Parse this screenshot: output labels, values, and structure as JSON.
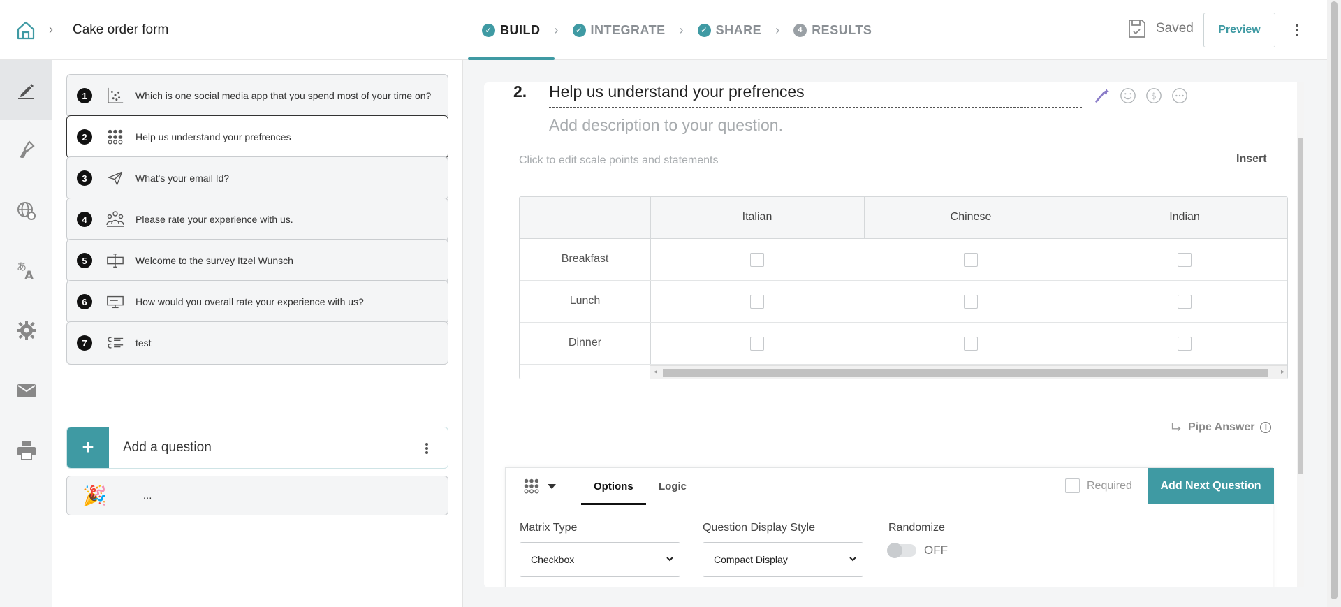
{
  "header": {
    "form_title": "Cake order form",
    "steps": [
      {
        "label": "BUILD",
        "badge": "✓"
      },
      {
        "label": "INTEGRATE",
        "badge": "✓"
      },
      {
        "label": "SHARE",
        "badge": "✓"
      },
      {
        "label": "RESULTS",
        "badge": "4"
      }
    ],
    "saved_label": "Saved",
    "preview_label": "Preview"
  },
  "colors": {
    "accent": "#3f9aa3",
    "text": "#333333",
    "muted": "#a7abae"
  },
  "sidebar": {
    "items": [
      {
        "icon": "pencil-icon",
        "active": true
      },
      {
        "icon": "paint-brush-icon"
      },
      {
        "icon": "globe-icon"
      },
      {
        "icon": "translate-icon"
      },
      {
        "icon": "gear-icon"
      },
      {
        "icon": "envelope-icon"
      },
      {
        "icon": "printer-icon"
      }
    ]
  },
  "questions": [
    {
      "num": "1",
      "icon": "scatter-icon",
      "text": "Which is one social media app that you spend most of your time on?"
    },
    {
      "num": "2",
      "icon": "matrix-grid-icon",
      "text": "Help us understand your prefrences"
    },
    {
      "num": "3",
      "icon": "paper-plane-icon",
      "text": "What's your email Id?"
    },
    {
      "num": "4",
      "icon": "people-icon",
      "text": "Please rate your experience with us."
    },
    {
      "num": "5",
      "icon": "welcome-icon",
      "text": "Welcome to the survey Itzel Wunsch"
    },
    {
      "num": "6",
      "icon": "monitor-icon",
      "text": "How would you overall rate your experience with us?"
    },
    {
      "num": "7",
      "icon": "list-icon",
      "text": "test"
    }
  ],
  "add_question_label": "Add a question",
  "end_card_text": "...",
  "editor": {
    "number": "2.",
    "title": "Help us understand your prefrences",
    "description_placeholder": "Add description to your question.",
    "scale_hint": "Click to edit scale points and statements",
    "insert_label": "Insert",
    "pipe_label": "Pipe Answer",
    "tools": [
      "magic-wand-icon",
      "smiley-icon",
      "dollar-icon",
      "more-icon"
    ]
  },
  "matrix": {
    "columns": [
      "Italian",
      "Chinese",
      "Indian"
    ],
    "rows": [
      "Breakfast",
      "Lunch",
      "Dinner"
    ]
  },
  "options_panel": {
    "tabs": [
      "Options",
      "Logic"
    ],
    "required_label": "Required",
    "next_button": "Add Next Question",
    "matrix_type_label": "Matrix Type",
    "matrix_type_value": "Checkbox",
    "display_style_label": "Question Display Style",
    "display_style_value": "Compact Display",
    "randomize_label": "Randomize",
    "randomize_value": "OFF"
  }
}
